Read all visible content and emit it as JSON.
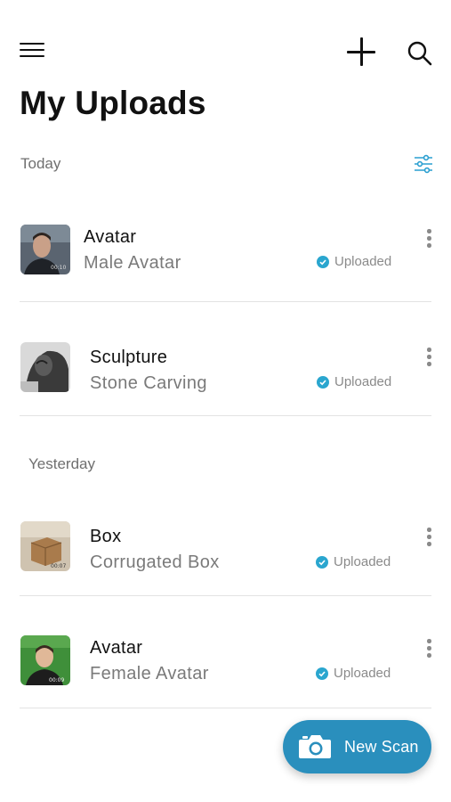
{
  "header": {
    "menu_icon": "hamburger-menu-icon",
    "add_icon": "plus-icon",
    "search_icon": "search-icon",
    "title": "My Uploads"
  },
  "sections": [
    {
      "label": "Today",
      "filter_icon": "sliders-filter-icon",
      "items": [
        {
          "title": "Avatar",
          "subtitle": "Male Avatar",
          "status": "Uploaded",
          "thumb_icon": "male-avatar-thumbnail"
        },
        {
          "title": "Sculpture",
          "subtitle": "Stone Carving",
          "status": "Uploaded",
          "thumb_icon": "sculpture-thumbnail"
        }
      ]
    },
    {
      "label": "Yesterday",
      "items": [
        {
          "title": "Box",
          "subtitle": "Corrugated Box",
          "status": "Uploaded",
          "thumb_icon": "box-thumbnail"
        },
        {
          "title": "Avatar",
          "subtitle": "Female Avatar",
          "status": "Uploaded",
          "thumb_icon": "female-avatar-thumbnail"
        }
      ]
    }
  ],
  "fab": {
    "label": "New Scan",
    "icon": "camera-icon"
  },
  "colors": {
    "accent": "#2a8fbd",
    "status_check": "#2aa6cf",
    "filter_icon": "#2a9fd0"
  }
}
